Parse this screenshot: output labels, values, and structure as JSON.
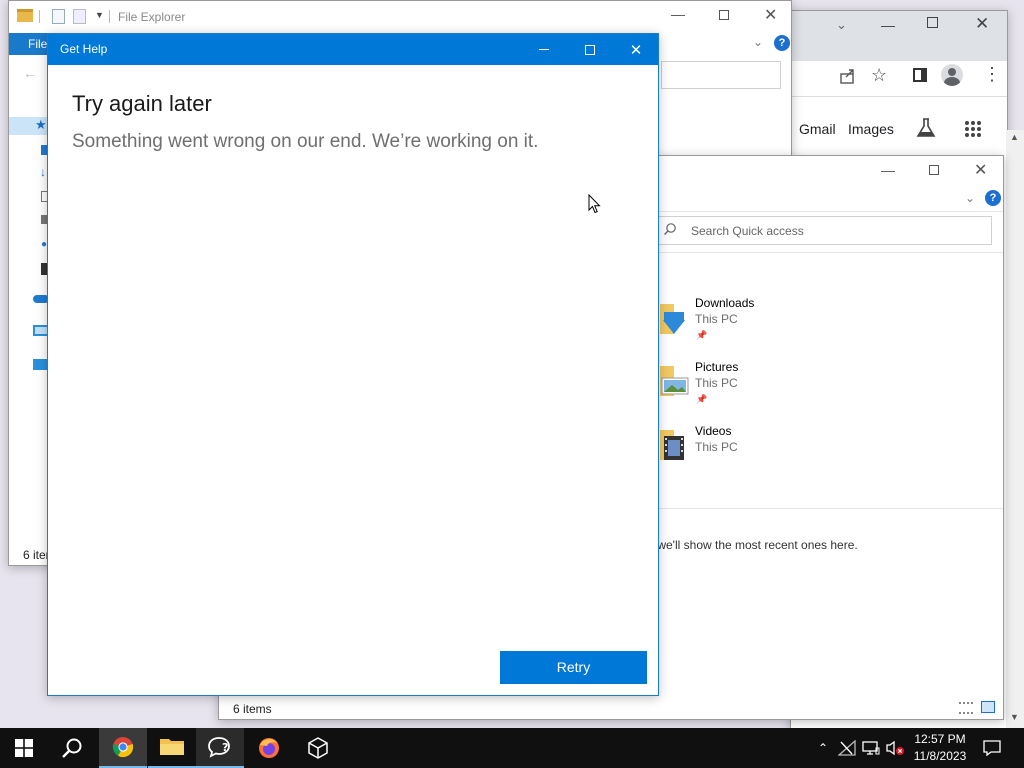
{
  "explorer_back": {
    "title": "File Explorer",
    "file_tab": "File",
    "status": "6 iter"
  },
  "chrome": {
    "link_gmail": "Gmail",
    "link_images": "Images"
  },
  "explorer_front": {
    "search_placeholder": "Search Quick access",
    "items": [
      {
        "name": "Downloads",
        "location": "This PC"
      },
      {
        "name": "Pictures",
        "location": "This PC"
      },
      {
        "name": "Videos",
        "location": "This PC"
      }
    ],
    "recent_message": "es, we'll show the most recent ones here.",
    "status": "6 items"
  },
  "get_help": {
    "title": "Get Help",
    "heading": "Try again later",
    "message": "Something went wrong on our end. We’re working on it.",
    "retry_label": "Retry"
  },
  "taskbar": {
    "time": "12:57 PM",
    "date": "11/8/2023"
  },
  "colors": {
    "accent": "#0078d7",
    "taskbar": "#101010",
    "taskbar_active": "#2b2b2b"
  }
}
